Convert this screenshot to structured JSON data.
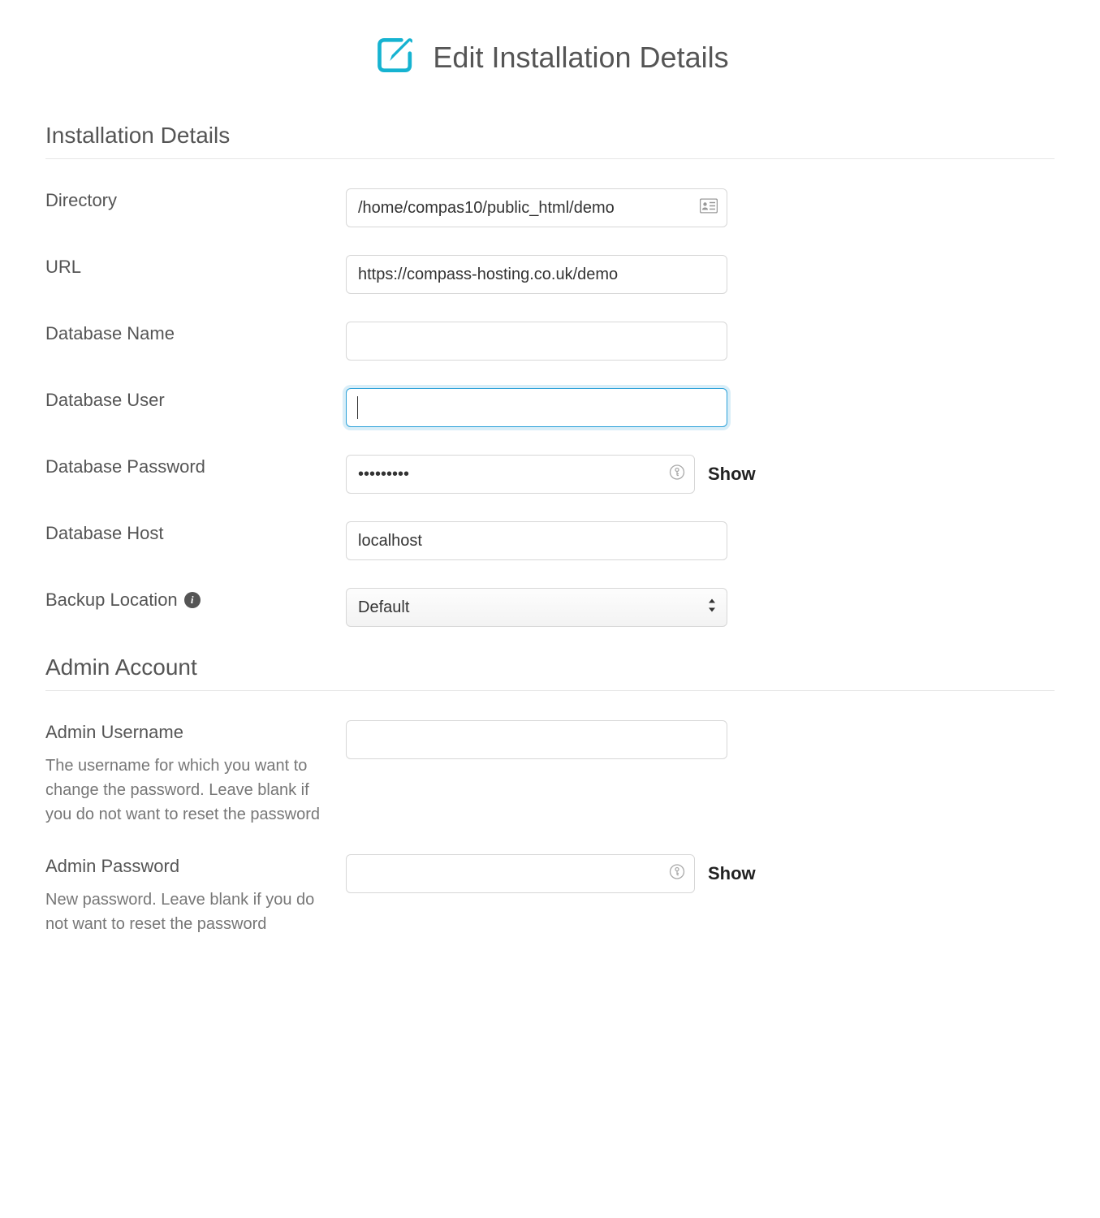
{
  "header": {
    "title": "Edit Installation Details"
  },
  "sections": {
    "install": {
      "title": "Installation Details"
    },
    "admin": {
      "title": "Admin Account"
    }
  },
  "fields": {
    "directory": {
      "label": "Directory",
      "value": "/home/compas10/public_html/demo"
    },
    "url": {
      "label": "URL",
      "value": "https://compass-hosting.co.uk/demo"
    },
    "db_name": {
      "label": "Database Name",
      "value": ""
    },
    "db_user": {
      "label": "Database User",
      "value": ""
    },
    "db_password": {
      "label": "Database Password",
      "value": "•••••••••",
      "toggle": "Show"
    },
    "db_host": {
      "label": "Database Host",
      "value": "localhost"
    },
    "backup_location": {
      "label": "Backup Location",
      "selected": "Default"
    },
    "admin_username": {
      "label": "Admin Username",
      "help": "The username for which you want to change the password. Leave blank if you do not want to reset the password",
      "value": ""
    },
    "admin_password": {
      "label": "Admin Password",
      "help": "New password. Leave blank if you do not want to reset the password",
      "value": "",
      "toggle": "Show"
    }
  }
}
